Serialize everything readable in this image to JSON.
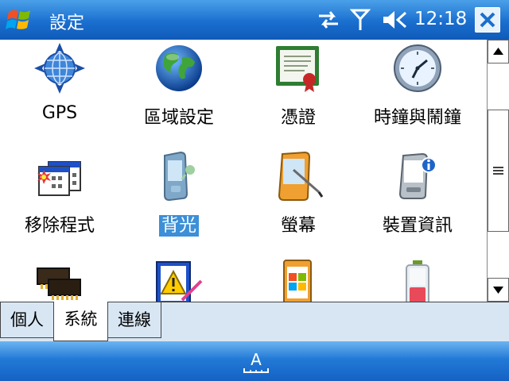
{
  "titlebar": {
    "title": "設定",
    "clock": "12:18"
  },
  "items": [
    {
      "label": "GPS",
      "icon": "gps-globe-icon"
    },
    {
      "label": "區域設定",
      "icon": "regional-globe-icon"
    },
    {
      "label": "憑證",
      "icon": "certificate-icon"
    },
    {
      "label": "時鐘與鬧鐘",
      "icon": "clock-alarm-icon"
    },
    {
      "label": "移除程式",
      "icon": "remove-programs-icon"
    },
    {
      "label": "背光",
      "icon": "backlight-icon",
      "selected": true
    },
    {
      "label": "螢幕",
      "icon": "screen-icon"
    },
    {
      "label": "裝置資訊",
      "icon": "device-info-icon"
    },
    {
      "label": "",
      "icon": "memory-icon"
    },
    {
      "label": "",
      "icon": "error-reporting-icon"
    },
    {
      "label": "",
      "icon": "windows-device-icon"
    },
    {
      "label": "",
      "icon": "battery-icon"
    }
  ],
  "tabs": [
    {
      "label": "個人"
    },
    {
      "label": "系統",
      "active": true
    },
    {
      "label": "連線"
    }
  ],
  "bottombar": {
    "sip_label": "A"
  },
  "colors": {
    "titlebar": "#1a6fcf",
    "selection": "#3c8fd8",
    "tabstrip": "#d8e6f4"
  }
}
